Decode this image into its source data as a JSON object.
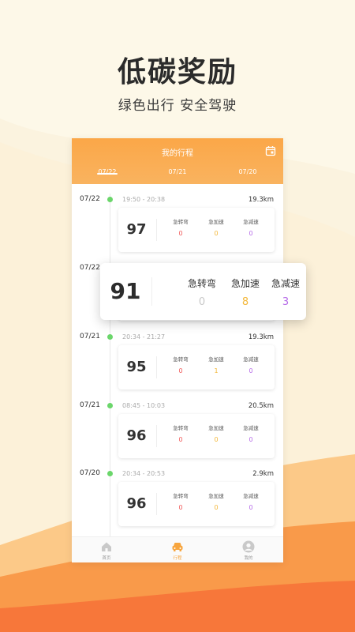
{
  "hero": {
    "title": "低碳奖励",
    "subtitle": "绿色出行 安全驾驶"
  },
  "app": {
    "title": "我的行程",
    "tabs": [
      {
        "label": "07/22",
        "active": true
      },
      {
        "label": "07/21",
        "active": false
      },
      {
        "label": "07/20",
        "active": false
      }
    ]
  },
  "metric_labels": {
    "turn": "急转弯",
    "accel": "急加速",
    "decel": "急减速"
  },
  "trips": [
    {
      "date": "07/22",
      "time": "19:50 - 20:38",
      "distance": "19.3km",
      "score": "97",
      "turn": "0",
      "accel": "0",
      "decel": "0"
    },
    {
      "date": "07/22",
      "time": "",
      "distance": "",
      "score": "",
      "turn": "",
      "accel": "",
      "decel": ""
    },
    {
      "date": "07/21",
      "time": "20:34 - 21:27",
      "distance": "19.3km",
      "score": "95",
      "turn": "0",
      "accel": "1",
      "decel": "0"
    },
    {
      "date": "07/21",
      "time": "08:45 - 10:03",
      "distance": "20.5km",
      "score": "96",
      "turn": "0",
      "accel": "0",
      "decel": "0"
    },
    {
      "date": "07/20",
      "time": "20:34 - 20:53",
      "distance": "2.9km",
      "score": "96",
      "turn": "0",
      "accel": "0",
      "decel": "0"
    }
  ],
  "popup": {
    "score": "91",
    "turn_label": "急转弯",
    "accel_label": "急加速",
    "decel_label": "急减速",
    "turn": "0",
    "accel": "8",
    "decel": "3"
  },
  "nav": {
    "home": "首页",
    "trips": "行程",
    "mine": "我的"
  },
  "colors": {
    "accent": "#f9a43f",
    "dot": "#6bd66b",
    "red": "#f15757",
    "yellow": "#f3b739",
    "purple": "#b66be8"
  }
}
